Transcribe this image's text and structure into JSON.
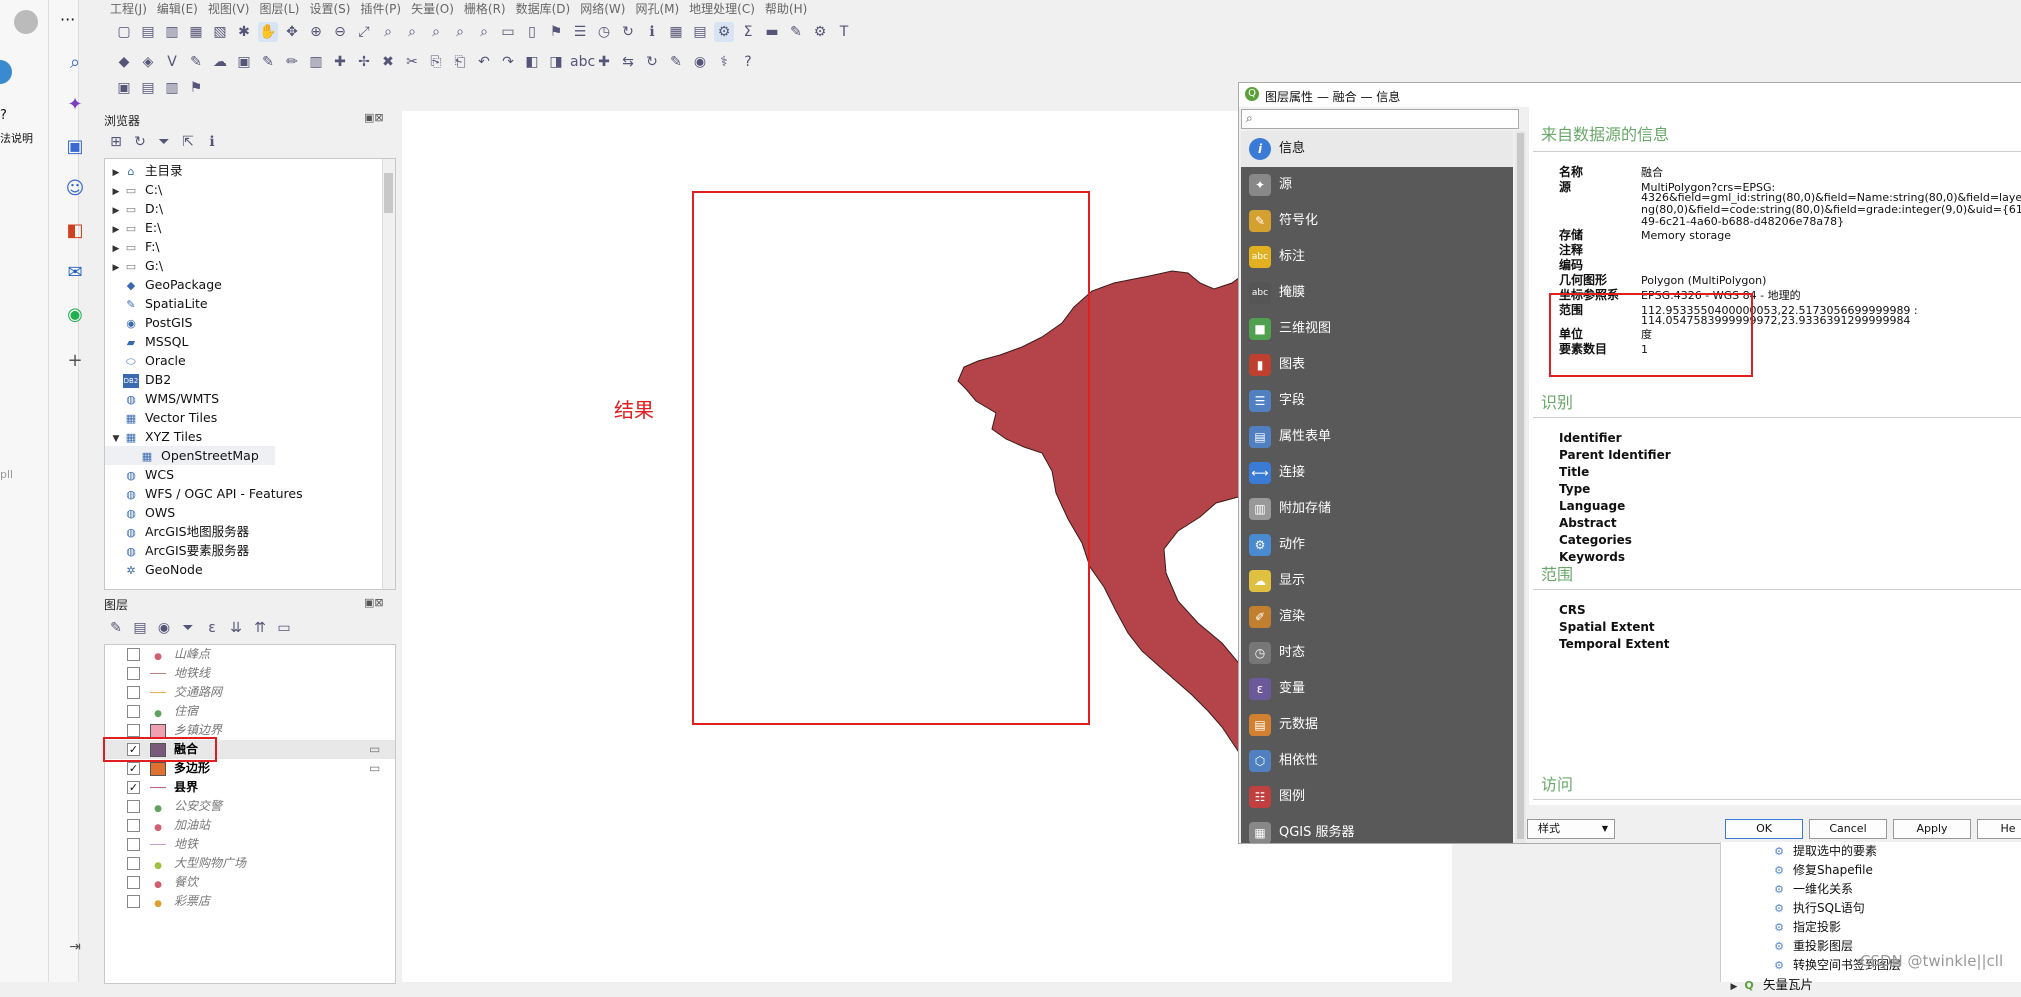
{
  "menu": [
    "工程(J)",
    "编辑(E)",
    "视图(V)",
    "图层(L)",
    "设置(S)",
    "插件(P)",
    "矢量(O)",
    "栅格(R)",
    "数据库(D)",
    "网络(W)",
    "网孔(M)",
    "地理处理(C)",
    "帮助(H)"
  ],
  "left_strip": {
    "label_fragment": "法说明",
    "label2": "pll"
  },
  "browser": {
    "title": "浏览器",
    "items": [
      {
        "label": "主目录",
        "icon": "home-icon",
        "expand": true
      },
      {
        "label": "C:\\",
        "icon": "folder-icon",
        "expand": true
      },
      {
        "label": "D:\\",
        "icon": "folder-icon",
        "expand": true
      },
      {
        "label": "E:\\",
        "icon": "folder-icon",
        "expand": true
      },
      {
        "label": "F:\\",
        "icon": "folder-icon",
        "expand": true
      },
      {
        "label": "G:\\",
        "icon": "folder-icon",
        "expand": true
      },
      {
        "label": "GeoPackage",
        "icon": "geopackage-icon",
        "expand": false
      },
      {
        "label": "SpatiaLite",
        "icon": "spatialite-icon",
        "expand": false
      },
      {
        "label": "PostGIS",
        "icon": "postgis-icon",
        "expand": false
      },
      {
        "label": "MSSQL",
        "icon": "mssql-icon",
        "expand": false
      },
      {
        "label": "Oracle",
        "icon": "oracle-icon",
        "expand": false
      },
      {
        "label": "DB2",
        "icon": "db2-icon",
        "expand": false
      },
      {
        "label": "WMS/WMTS",
        "icon": "globe-icon",
        "expand": false
      },
      {
        "label": "Vector Tiles",
        "icon": "grid-icon",
        "expand": false
      },
      {
        "label": "XYZ Tiles",
        "icon": "grid-icon",
        "expand": "open"
      },
      {
        "label": "OpenStreetMap",
        "icon": "grid-icon",
        "expand": false,
        "child": true
      },
      {
        "label": "WCS",
        "icon": "globe-icon",
        "expand": false
      },
      {
        "label": "WFS / OGC API - Features",
        "icon": "globe-icon",
        "expand": false
      },
      {
        "label": "OWS",
        "icon": "globe-icon",
        "expand": false
      },
      {
        "label": "ArcGIS地图服务器",
        "icon": "globe-icon",
        "expand": false
      },
      {
        "label": "ArcGIS要素服务器",
        "icon": "globe-icon",
        "expand": false
      },
      {
        "label": "GeoNode",
        "icon": "geonode-icon",
        "expand": false
      }
    ]
  },
  "layers": {
    "title": "图层",
    "items": [
      {
        "label": "山峰点",
        "checked": false,
        "sym": "dot",
        "color": "#d06070"
      },
      {
        "label": "地铁线",
        "checked": false,
        "sym": "line",
        "color": "#c08080"
      },
      {
        "label": "交通路网",
        "checked": false,
        "sym": "line",
        "color": "#e0b060"
      },
      {
        "label": "住宿",
        "checked": false,
        "sym": "dot",
        "color": "#60a060"
      },
      {
        "label": "乡镇边界",
        "checked": false,
        "sym": "fill",
        "color": "#f0a0b0"
      },
      {
        "label": "融合",
        "checked": true,
        "sym": "fill",
        "color": "#7a5a7a"
      },
      {
        "label": "多边形",
        "checked": true,
        "sym": "fill",
        "color": "#e07030"
      },
      {
        "label": "县界",
        "checked": true,
        "sym": "line",
        "color": "#c06080"
      },
      {
        "label": "公安交警",
        "checked": false,
        "sym": "dot",
        "color": "#60a060"
      },
      {
        "label": "加油站",
        "checked": false,
        "sym": "dot",
        "color": "#d06070"
      },
      {
        "label": "地铁",
        "checked": false,
        "sym": "line",
        "color": "#c0a0d0"
      },
      {
        "label": "大型购物广场",
        "checked": false,
        "sym": "dot",
        "color": "#a0c040"
      },
      {
        "label": "餐饮",
        "checked": false,
        "sym": "dot",
        "color": "#d06070"
      },
      {
        "label": "彩票店",
        "checked": false,
        "sym": "dot",
        "color": "#e0a030"
      }
    ]
  },
  "canvas": {
    "result_label": "结果",
    "polygon_color": "#b5444a",
    "frame_color": "#e02020"
  },
  "dialog": {
    "title": "图层属性 — 融合 — 信息",
    "search_placeholder": "",
    "nav": [
      {
        "label": "信息",
        "icon": "info-icon",
        "color": "#3a7bd5",
        "selected": true
      },
      {
        "label": "源",
        "icon": "wrench-icon",
        "color": "#888"
      },
      {
        "label": "符号化",
        "icon": "brush-icon",
        "color": "#d4a030"
      },
      {
        "label": "标注",
        "icon": "abc-label-icon",
        "color": "#e0b020"
      },
      {
        "label": "掩膜",
        "icon": "abc-mask-icon",
        "color": "#555"
      },
      {
        "label": "三维视图",
        "icon": "cube-icon",
        "color": "#50a050"
      },
      {
        "label": "图表",
        "icon": "chart-icon",
        "color": "#c04030"
      },
      {
        "label": "字段",
        "icon": "fields-icon",
        "color": "#5080c0"
      },
      {
        "label": "属性表单",
        "icon": "form-icon",
        "color": "#5080c0"
      },
      {
        "label": "连接",
        "icon": "join-icon",
        "color": "#3a7bd5"
      },
      {
        "label": "附加存储",
        "icon": "storage-icon",
        "color": "#999"
      },
      {
        "label": "动作",
        "icon": "gear-icon",
        "color": "#4a8ad0"
      },
      {
        "label": "显示",
        "icon": "speech-icon",
        "color": "#e0c040"
      },
      {
        "label": "渲染",
        "icon": "paintbrush-icon",
        "color": "#c08030"
      },
      {
        "label": "时态",
        "icon": "clock-icon",
        "color": "#777"
      },
      {
        "label": "变量",
        "icon": "variable-icon",
        "color": "#6a5a9a"
      },
      {
        "label": "元数据",
        "icon": "document-icon",
        "color": "#d08030"
      },
      {
        "label": "相依性",
        "icon": "dependency-icon",
        "color": "#5080c0"
      },
      {
        "label": "图例",
        "icon": "legend-icon",
        "color": "#c04040"
      },
      {
        "label": "QGIS 服务器",
        "icon": "server-icon",
        "color": "#888"
      }
    ],
    "info": {
      "heading": "来自数据源的信息",
      "rows": [
        {
          "k": "名称",
          "v": "融合"
        },
        {
          "k": "源",
          "v": "MultiPolygon?crs=EPSG:"
        },
        {
          "k": "",
          "v": "4326&field=gml_id:string(80,0)&field=Name:string(80,0)&field=layer:st"
        },
        {
          "k": "",
          "v": "ng(80,0)&field=code:string(80,0)&field=grade:integer(9,0)&uid={61ce7"
        },
        {
          "k": "",
          "v": "49-6c21-4a60-b688-d48206e78a78}"
        },
        {
          "k": "存储",
          "v": "Memory storage"
        },
        {
          "k": "注释",
          "v": ""
        },
        {
          "k": "编码",
          "v": ""
        },
        {
          "k": "几何图形",
          "v": "Polygon (MultiPolygon)"
        },
        {
          "k": "坐标参照系",
          "v": "EPSG:4326 - WGS 84 - 地理的"
        },
        {
          "k": "范围",
          "v": "112.9533550400000053,22.5173056699999989 :"
        },
        {
          "k": "",
          "v": "114.0547583999999972,23.9336391299999984"
        },
        {
          "k": "单位",
          "v": "度"
        },
        {
          "k": "要素数目",
          "v": "1"
        }
      ],
      "identify_heading": "识别",
      "identify_keys": [
        "Identifier",
        "Parent Identifier",
        "Title",
        "Type",
        "Language",
        "Abstract",
        "Categories",
        "Keywords"
      ],
      "extent_heading": "范围",
      "extent_keys": [
        "CRS",
        "Spatial Extent",
        "Temporal Extent"
      ],
      "access_heading": "访问"
    },
    "style_button": "样式",
    "ok": "OK",
    "cancel": "Cancel",
    "apply": "Apply",
    "help": "He"
  },
  "processing": {
    "items": [
      "提取选中的要素",
      "修复Shapefile",
      "一维化关系",
      "执行SQL语句",
      "指定投影",
      "重投影图层",
      "转换空间书签到图层"
    ],
    "group": "矢量瓦片"
  },
  "watermark": "CSDN @twinkle||cll"
}
